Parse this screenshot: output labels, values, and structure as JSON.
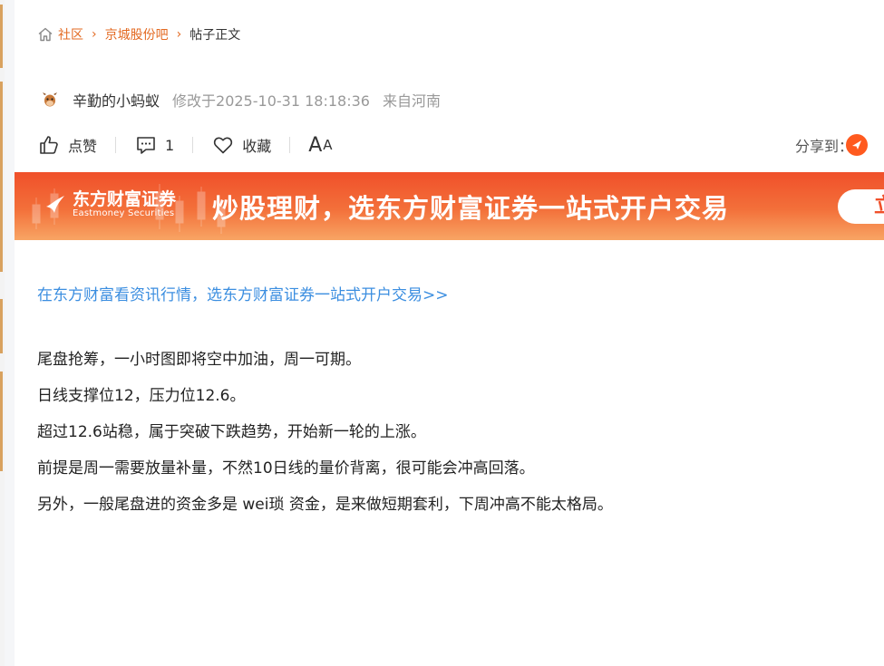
{
  "breadcrumb": {
    "home_icon": "home-icon",
    "items": [
      "社区",
      "京城股份吧",
      "帖子正文"
    ]
  },
  "post": {
    "author": "辛勤的小蚂蚁",
    "modified": "修改于2025-10-31 18:18:36",
    "location": "来自河南"
  },
  "actions": {
    "like_label": "点赞",
    "comment_count": "1",
    "favorite_label": "收藏",
    "font_large": "A",
    "font_small": "A",
    "share_label": "分享到："
  },
  "banner": {
    "logo_cn": "东方财富证券",
    "logo_en": "Eastmoney Securities",
    "slogan": "炒股理财，选东方财富证券一站式开户交易",
    "button_label": "立"
  },
  "promo_link": "在东方财富看资讯行情，选东方财富证券一站式开户交易>>",
  "content": [
    "尾盘抢筹，一小时图即将空中加油，周一可期。",
    "日线支撑位12，压力位12.6。",
    "超过12.6站稳，属于突破下跌趋势，开始新一轮的上涨。",
    "前提是周一需要放量补量，不然10日线的量价背离，很可能会冲高回落。",
    "另外，一般尾盘进的资金多是 wei琐 资金，是来做短期套利，下周冲高不能太格局。"
  ],
  "colors": {
    "accent": "#e36a22",
    "link": "#3b8ee0",
    "banner_top": "#f0502a",
    "banner_bottom": "#f8a564"
  }
}
